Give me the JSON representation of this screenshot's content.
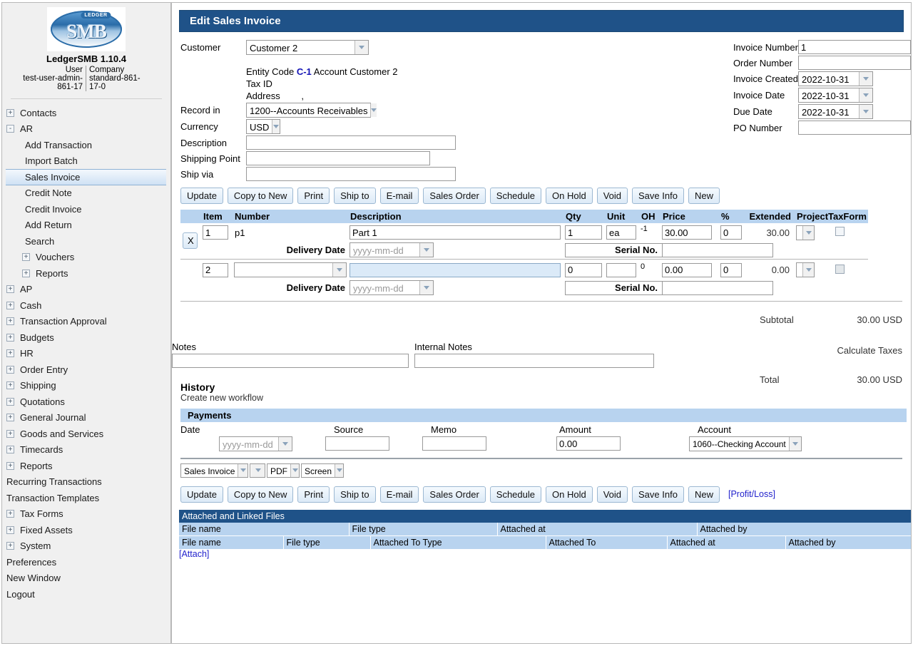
{
  "sidebar": {
    "logo_badge": "LEDGER",
    "logo_text": "SMB",
    "app_version": "LedgerSMB 1.10.4",
    "user_label": "User",
    "user_value": "test-user-admin-861-17",
    "company_label": "Company",
    "company_value": "standard-861-17-0",
    "items": [
      {
        "label": "Contacts",
        "level": 1,
        "toggle": "+",
        "selected": false
      },
      {
        "label": "AR",
        "level": 1,
        "toggle": "-",
        "selected": false
      },
      {
        "label": "Add Transaction",
        "level": 2,
        "toggle": "",
        "selected": false
      },
      {
        "label": "Import Batch",
        "level": 2,
        "toggle": "",
        "selected": false
      },
      {
        "label": "Sales Invoice",
        "level": 2,
        "toggle": "",
        "selected": true
      },
      {
        "label": "Credit Note",
        "level": 2,
        "toggle": "",
        "selected": false
      },
      {
        "label": "Credit Invoice",
        "level": 2,
        "toggle": "",
        "selected": false
      },
      {
        "label": "Add Return",
        "level": 2,
        "toggle": "",
        "selected": false
      },
      {
        "label": "Search",
        "level": 2,
        "toggle": "",
        "selected": false
      },
      {
        "label": "Vouchers",
        "level": 2,
        "toggle": "+",
        "selected": false
      },
      {
        "label": "Reports",
        "level": 2,
        "toggle": "+",
        "selected": false
      },
      {
        "label": "AP",
        "level": 1,
        "toggle": "+",
        "selected": false
      },
      {
        "label": "Cash",
        "level": 1,
        "toggle": "+",
        "selected": false
      },
      {
        "label": "Transaction Approval",
        "level": 1,
        "toggle": "+",
        "selected": false
      },
      {
        "label": "Budgets",
        "level": 1,
        "toggle": "+",
        "selected": false
      },
      {
        "label": "HR",
        "level": 1,
        "toggle": "+",
        "selected": false
      },
      {
        "label": "Order Entry",
        "level": 1,
        "toggle": "+",
        "selected": false
      },
      {
        "label": "Shipping",
        "level": 1,
        "toggle": "+",
        "selected": false
      },
      {
        "label": "Quotations",
        "level": 1,
        "toggle": "+",
        "selected": false
      },
      {
        "label": "General Journal",
        "level": 1,
        "toggle": "+",
        "selected": false
      },
      {
        "label": "Goods and Services",
        "level": 1,
        "toggle": "+",
        "selected": false
      },
      {
        "label": "Timecards",
        "level": 1,
        "toggle": "+",
        "selected": false
      },
      {
        "label": "Reports",
        "level": 1,
        "toggle": "+",
        "selected": false
      },
      {
        "label": "Recurring Transactions",
        "level": 1,
        "toggle": "",
        "selected": false
      },
      {
        "label": "Transaction Templates",
        "level": 1,
        "toggle": "",
        "selected": false
      },
      {
        "label": "Tax Forms",
        "level": 1,
        "toggle": "+",
        "selected": false
      },
      {
        "label": "Fixed Assets",
        "level": 1,
        "toggle": "+",
        "selected": false
      },
      {
        "label": "System",
        "level": 1,
        "toggle": "+",
        "selected": false
      },
      {
        "label": "Preferences",
        "level": 1,
        "toggle": "",
        "selected": false
      },
      {
        "label": "New Window",
        "level": 1,
        "toggle": "",
        "selected": false
      },
      {
        "label": "Logout",
        "level": 1,
        "toggle": "",
        "selected": false
      }
    ]
  },
  "page": {
    "title": "Edit Sales Invoice",
    "accent_dark": "#1f5288",
    "accent_light": "#b8d3ef"
  },
  "customer": {
    "label": "Customer",
    "value": "Customer 2",
    "entity_code_label": "Entity Code",
    "entity_code_value": "C-1",
    "account_label": "Account",
    "account_value": "Customer 2",
    "tax_id_label": "Tax ID",
    "tax_id_value": "",
    "address_label": "Address",
    "address_value": ","
  },
  "form_left": {
    "record_in_label": "Record in",
    "record_in_value": "1200--Accounts Receivables",
    "currency_label": "Currency",
    "currency_value": "USD",
    "description_label": "Description",
    "description_value": "",
    "shipping_point_label": "Shipping Point",
    "shipping_point_value": "",
    "ship_via_label": "Ship via",
    "ship_via_value": ""
  },
  "form_right": {
    "invoice_number_label": "Invoice Number",
    "invoice_number_value": "1",
    "order_number_label": "Order Number",
    "order_number_value": "",
    "invoice_created_label": "Invoice Created",
    "invoice_created_value": "2022-10-31",
    "invoice_date_label": "Invoice Date",
    "invoice_date_value": "2022-10-31",
    "due_date_label": "Due Date",
    "due_date_value": "2022-10-31",
    "po_number_label": "PO Number",
    "po_number_value": ""
  },
  "actions": {
    "update": "Update",
    "copy_to_new": "Copy to New",
    "print": "Print",
    "ship_to": "Ship to",
    "email": "E-mail",
    "sales_order": "Sales Order",
    "schedule": "Schedule",
    "on_hold": "On Hold",
    "void": "Void",
    "save_info": "Save Info",
    "new": "New",
    "profit_loss": "[Profit/Loss]"
  },
  "items_table": {
    "headers": {
      "item": "Item",
      "number": "Number",
      "description": "Description",
      "qty": "Qty",
      "unit": "Unit",
      "oh": "OH",
      "price": "Price",
      "pct": "%",
      "extended": "Extended",
      "project": "Project",
      "taxform": "TaxForm"
    },
    "delete_label": "X",
    "delivery_date_label": "Delivery Date",
    "delivery_date_placeholder": "yyyy-mm-dd",
    "serial_label": "Serial No.",
    "rows": [
      {
        "item": "1",
        "number": "p1",
        "number_is_select": false,
        "description": "Part 1",
        "description_focused": false,
        "delivery_date": "",
        "serial_no": "",
        "qty": "1",
        "unit": "ea",
        "oh": "-1",
        "price": "30.00",
        "pct": "0",
        "extended": "30.00",
        "project": "",
        "has_delete": true
      },
      {
        "item": "2",
        "number": "",
        "number_is_select": true,
        "description": "",
        "description_focused": true,
        "delivery_date": "",
        "serial_no": "",
        "qty": "0",
        "unit": "",
        "oh": "0",
        "price": "0.00",
        "pct": "0",
        "extended": "0.00",
        "project": "",
        "has_delete": false
      }
    ]
  },
  "totals": {
    "subtotal_label": "Subtotal",
    "subtotal_value": "30.00 USD",
    "calculate_taxes_label": "Calculate Taxes",
    "total_label": "Total",
    "total_value": "30.00 USD"
  },
  "notes": {
    "notes_label": "Notes",
    "notes_value": "",
    "internal_notes_label": "Internal Notes",
    "internal_notes_value": ""
  },
  "history": {
    "title": "History",
    "create_workflow": "Create new workflow"
  },
  "payments": {
    "section_title": "Payments",
    "date_label": "Date",
    "source_label": "Source",
    "memo_label": "Memo",
    "amount_label": "Amount",
    "account_label": "Account",
    "date_placeholder": "yyyy-mm-dd",
    "date_value": "",
    "source_value": "",
    "memo_value": "",
    "amount_value": "0.00",
    "account_value": "1060--Checking Account"
  },
  "print_options": {
    "form": "Sales Invoice",
    "language": "",
    "format": "PDF",
    "media": "Screen"
  },
  "attachments": {
    "section_title": "Attached and Linked Files",
    "headers_files": [
      "File name",
      "File type",
      "Attached at",
      "Attached by"
    ],
    "headers_links": [
      "File name",
      "File type",
      "Attached To Type",
      "Attached To",
      "Attached at",
      "Attached by"
    ],
    "attach_link": "[Attach]"
  }
}
